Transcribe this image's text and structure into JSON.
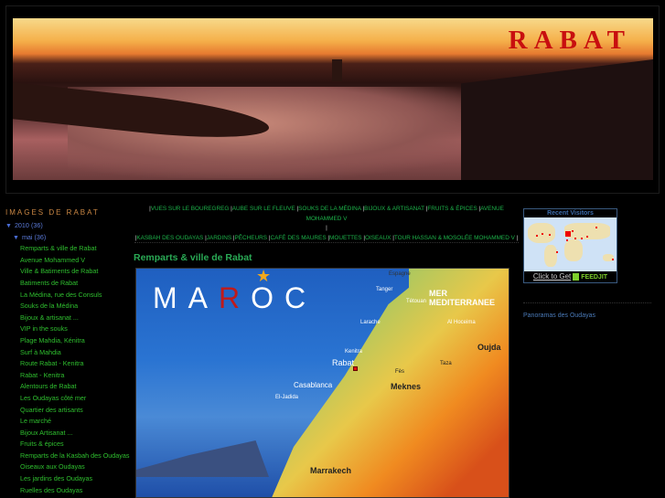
{
  "header": {
    "title": "RABAT"
  },
  "sidebar": {
    "heading": "IMAGES DE RABAT",
    "year": {
      "label": "2010",
      "count": "(36)"
    },
    "month": {
      "label": "mai",
      "count": "(36)"
    },
    "posts": [
      "Remparts & ville de Rabat",
      "Avenue Mohammed V",
      "Ville & Batiments de Rabat",
      "Batiments de Rabat",
      "La Médina, rue des Consuls",
      "Souks de la Médina",
      "Bijoux & artisanat ...",
      "VIP in the souks",
      "Plage Mahdia, Kénitra",
      "Surf à Mahdia",
      "Route Rabat - Kenitra",
      "Rabat - Kenitra",
      "Alentours de Rabat",
      "Les Oudayas côté mer",
      "Quartier des artisants",
      "Le marché",
      "Bijoux Artisanat ...",
      "Fruits & épices",
      "Remparts de la Kasbah des Oudayas",
      "Oiseaux aux Oudayas",
      "Les jardins des Oudayas",
      "Ruelles des Oudayas"
    ]
  },
  "nav": {
    "row1": [
      "VUES SUR LE BOUREGREG",
      "AUBE SUR LE FLEUVE",
      "SOUKS DE LA MÉDINA",
      "BIJOUX & ARTISANAT",
      "FRUITS & ÉPICES",
      "AVENUE MOHAMMED V"
    ],
    "row2": [
      "KASBAH DES OUDAYAS",
      "JARDINS",
      "PÊCHEURS",
      "CAFÉ DES MAURES",
      "MOUETTES",
      "OISEAUX",
      "TOUR HASSAN & MOSOLÉE MOHAMMED V"
    ],
    "separator": "|"
  },
  "post": {
    "title": "Remparts & ville de Rabat",
    "map": {
      "title_a": "MA",
      "title_r": "R",
      "title_b": "OC",
      "sea": "MER MEDITERRANEE",
      "cities": {
        "espagne": "Espagne",
        "tanger": "Tanger",
        "tetouan": "Tétouan",
        "larache": "Larache",
        "kenitra": "Kenitra",
        "rabat": "Rabat",
        "casablanca": "Casablanca",
        "eljadida": "El-Jadida",
        "oujda": "Oujda",
        "meknes": "Meknes",
        "fes": "Fès",
        "marrakech": "Marrakech",
        "alhoceima": "Al Hoceima",
        "taza": "Taza"
      }
    }
  },
  "widget": {
    "title": "Recent Visitors",
    "cta": "Click to Get",
    "brand": "FEEDJIT",
    "link": "Panoramas des Oudayas"
  }
}
